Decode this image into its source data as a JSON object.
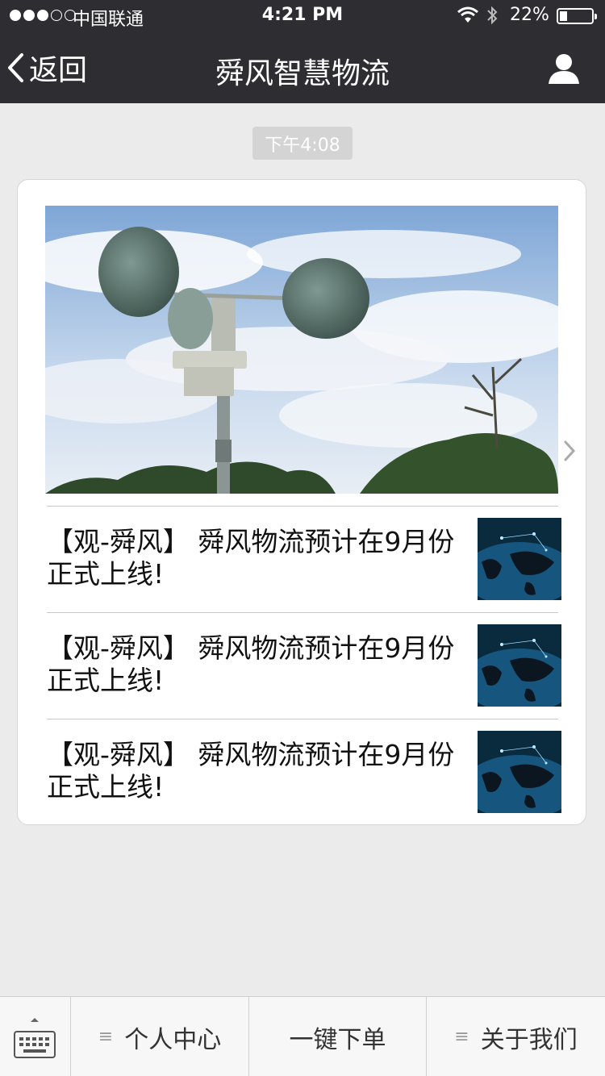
{
  "status_bar": {
    "carrier": "中国联通",
    "time": "4:21 PM",
    "battery": "22%",
    "battery_level": 0.22,
    "signal_bars": 3,
    "icons": [
      "signal-dots-icon",
      "wifi-icon",
      "bluetooth-icon",
      "battery-icon"
    ]
  },
  "nav": {
    "back_label": "返回",
    "title": "舜风智慧物流",
    "icons": [
      "chevron-left-icon",
      "person-icon"
    ]
  },
  "chat": {
    "timestamp": "下午4:08",
    "hero_image": "anemometer-photo",
    "articles": [
      {
        "title": "【观-舜风】 舜风物流预计在9月份正式上线!",
        "thumbnail": "world-map-network-image"
      },
      {
        "title": "【观-舜风】 舜风物流预计在9月份正式上线!",
        "thumbnail": "world-map-network-image"
      },
      {
        "title": "【观-舜风】 舜风物流预计在9月份正式上线!",
        "thumbnail": "world-map-network-image"
      }
    ]
  },
  "menu": {
    "items": [
      {
        "label": "个人中心",
        "has_submenu": true
      },
      {
        "label": "一键下单",
        "has_submenu": false
      },
      {
        "label": "关于我们",
        "has_submenu": true
      }
    ],
    "icons": [
      "keyboard-icon",
      "caret-up-icon",
      "menu-lines-icon"
    ]
  }
}
